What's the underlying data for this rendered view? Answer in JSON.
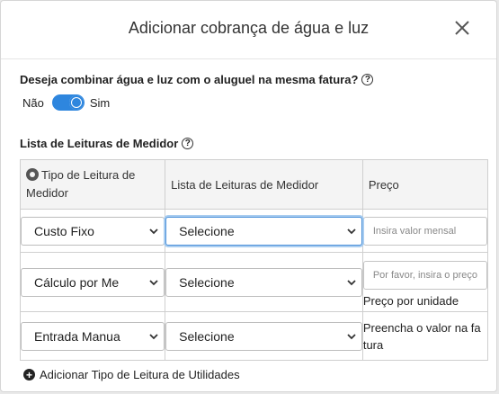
{
  "dialog": {
    "title": "Adicionar cobrança de água e luz",
    "close_icon": "close-icon"
  },
  "combine": {
    "question": "Deseja combinar água e luz com o aluguel na mesma fatura?",
    "help_icon": "question-circle-icon",
    "off_label": "Não",
    "on_label": "Sim",
    "enabled": true,
    "accent_color": "#2e86de"
  },
  "readings": {
    "title": "Lista de Leituras de Medidor",
    "help_icon": "question-circle-icon",
    "columns": [
      "Tipo de Leitura de Medidor",
      "Lista de Leituras de Medidor",
      "Preço"
    ],
    "rows": [
      {
        "type_value": "Custo Fixo",
        "list_value": "Selecione",
        "price_placeholder": "Insira valor mensal",
        "price_note": ""
      },
      {
        "type_value": "Cálculo por Me",
        "list_value": "Selecione",
        "price_placeholder": "Por favor, insira o preço",
        "price_note": "Preço por unidade"
      },
      {
        "type_value": "Entrada Manua",
        "list_value": "Selecione",
        "price_placeholder": "",
        "price_note_line1": "Preencha o valor na fa",
        "price_note_line2": "tura"
      }
    ]
  },
  "add_action": {
    "label": "Adicionar Tipo de Leitura de Utilidades",
    "icon": "plus-circle-icon"
  }
}
